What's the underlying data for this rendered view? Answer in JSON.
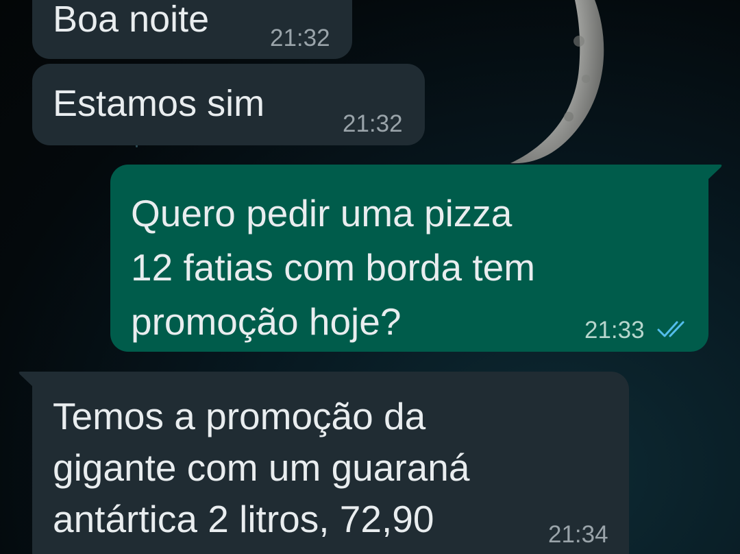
{
  "chat": {
    "messages": [
      {
        "direction": "incoming",
        "text": "Boa noite",
        "time": "21:32"
      },
      {
        "direction": "incoming",
        "text": "Estamos sim",
        "time": "21:32"
      },
      {
        "direction": "outgoing",
        "text": "Quero pedir uma pizza\n12 fatias com borda tem\npromoção hoje?",
        "time": "21:33",
        "status_icon": "double-check-read-icon"
      },
      {
        "direction": "incoming",
        "text": "Temos a promoção da\ngigante com um guaraná\nantártica 2 litros, 72,90",
        "time": "21:34"
      }
    ]
  },
  "theme": {
    "incoming_bubble": "#202c33",
    "outgoing_bubble": "#005c4b",
    "text": "#e9edef",
    "read_check": "#53bdeb",
    "wallpaper": "night-sky-moon"
  }
}
